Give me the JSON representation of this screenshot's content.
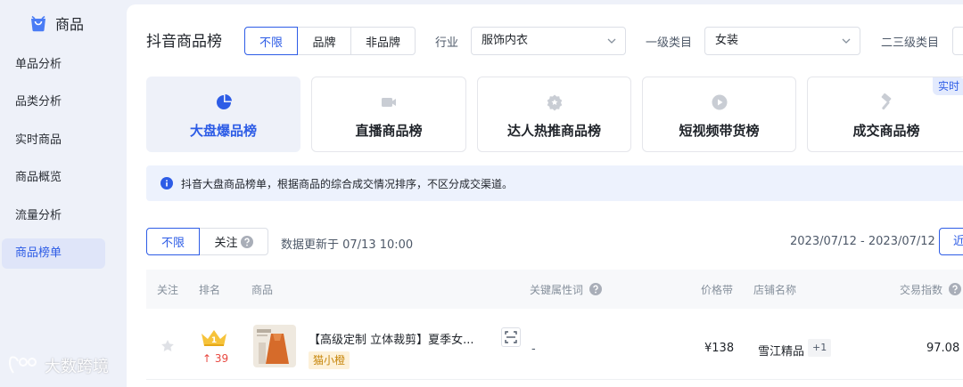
{
  "app": {
    "brand": "商品"
  },
  "sidebar": {
    "items": [
      {
        "label": "单品分析"
      },
      {
        "label": "品类分析"
      },
      {
        "label": "实时商品"
      },
      {
        "label": "商品概览"
      },
      {
        "label": "流量分析"
      },
      {
        "label": "商品榜单",
        "active": true
      }
    ]
  },
  "watermark": "大数跨境",
  "header": {
    "title": "抖音商品榜",
    "brand_filter": [
      "不限",
      "品牌",
      "非品牌"
    ],
    "industry_label": "行业",
    "industry_value": "服饰内衣",
    "category1_label": "一级类目",
    "category1_value": "女装",
    "category23_label": "二三级类目"
  },
  "boards": [
    {
      "label": "大盘爆品榜",
      "icon": "pie-chart-icon",
      "active": true
    },
    {
      "label": "直播商品榜",
      "icon": "video-icon"
    },
    {
      "label": "达人热推商品榜",
      "icon": "star-badge-icon"
    },
    {
      "label": "短视频带货榜",
      "icon": "play-icon"
    },
    {
      "label": "成交商品榜",
      "icon": "hammer-icon",
      "badge": "实时"
    }
  ],
  "info": {
    "text": "抖音大盘商品榜单，根据商品的综合成交情况排序，不区分成交渠道。"
  },
  "toolbar": {
    "follow_filter": [
      "不限",
      "关注"
    ],
    "update_text": "数据更新于 07/13 10:00",
    "date_range": "2023/07/12 - 2023/07/12",
    "near_label": "近"
  },
  "table": {
    "headers": {
      "follow": "关注",
      "rank": "排名",
      "product": "商品",
      "keywords": "关键属性词",
      "price": "价格带",
      "shop": "店铺名称",
      "index": "交易指数"
    },
    "rows": [
      {
        "rank": 1,
        "rank_change": "39",
        "title": "【高级定制 立体裁剪】夏季女...",
        "tag": "猫小橙",
        "keywords": "-",
        "price": "¥138",
        "shop": "雪江精品",
        "shop_more": "+1",
        "index": "97.08"
      }
    ]
  },
  "colors": {
    "accent": "#2d5ce6",
    "rank_up": "#e8473f",
    "tag_bg": "#fdf1d9"
  }
}
